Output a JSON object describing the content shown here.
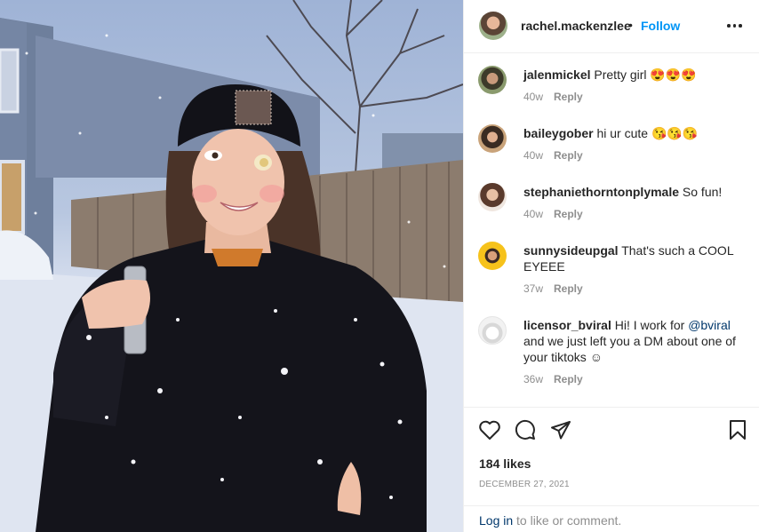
{
  "header": {
    "username": "rachel.mackenzlee",
    "separator": "•",
    "follow_label": "Follow",
    "more_icon": "more-options-icon"
  },
  "comments": [
    {
      "username": "jalenmickel",
      "text": "Pretty girl 😍😍😍",
      "time": "40w",
      "reply_label": "Reply"
    },
    {
      "username": "baileygober",
      "text": "hi ur cute 😘😘😘",
      "time": "40w",
      "reply_label": "Reply"
    },
    {
      "username": "stephaniethorntonplymale",
      "text": "So fun!",
      "time": "40w",
      "reply_label": "Reply"
    },
    {
      "username": "sunnysideupgal",
      "text": "That's such a COOL EYEEE",
      "time": "37w",
      "reply_label": "Reply"
    },
    {
      "username": "licensor_bviral",
      "text_before": "Hi! I work for ",
      "mention": "@bviral",
      "text_after": " and we just left you a DM about one of your tiktoks ☺",
      "time": "36w",
      "reply_label": "Reply"
    }
  ],
  "actions": {
    "icons": [
      "heart-icon",
      "comment-icon",
      "share-icon",
      "bookmark-icon"
    ],
    "likes": "184 likes",
    "date": "DECEMBER 27, 2021"
  },
  "footer": {
    "login_label": "Log in",
    "login_suffix": " to like or comment."
  }
}
